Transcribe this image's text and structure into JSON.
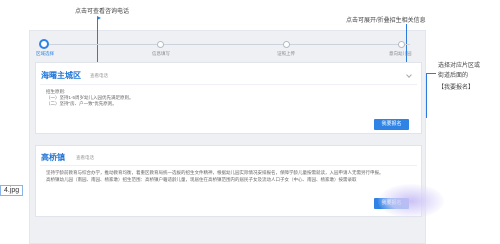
{
  "annotations": {
    "top_left": "点击可查看咨询电话",
    "top_right": "点击可展开/折叠招生相关信息",
    "side_lines": [
      "选择对应片区或",
      "街道后面的",
      "【我要报名】"
    ]
  },
  "steps": [
    {
      "label": "区域选择",
      "active": true
    },
    {
      "label": "信息填写",
      "active": false
    },
    {
      "label": "证照上传",
      "active": false
    },
    {
      "label": "意向幼儿园",
      "active": false
    }
  ],
  "card1": {
    "title": "海曙主城区",
    "subtitle": "查看电话",
    "policy_heading": "招生原则:",
    "policy_lines": [
      "（一）坚持1-5周岁幼儿入园优先满足原则。",
      "（二）坚持\"房、户一致\"优先原则。"
    ],
    "button": "我要报名"
  },
  "card2": {
    "title": "高桥镇",
    "subtitle": "查看电话",
    "text_lines": [
      "坚持学龄前教育与综合办学，推动教育均衡，着重区教育局统一选拔的招生文件精神，根据幼儿园实际情况安排报名，保障学龄儿童按需就读，入园申请人无需另行申报。",
      "高桥镇幼儿园（南园、南园、杨家墩）招生范围：高桥镇户籍适龄儿童，现居住在高桥镇范围内的居民子女及流动人口子女（中心、南园、杨家墩）按需录取"
    ],
    "button": "我要报名"
  },
  "file_label": "4.jpg"
}
